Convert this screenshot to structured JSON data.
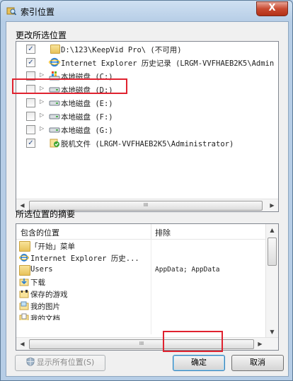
{
  "window": {
    "title": "索引位置",
    "close_label": "X"
  },
  "locations_group": {
    "label": "更改所选位置",
    "items": [
      {
        "checked": true,
        "check_mark": "✓",
        "expander": "",
        "icon": "folder-icon",
        "label": "D:\\123\\KeepVid Pro\\ (不可用)"
      },
      {
        "checked": true,
        "check_mark": "✓",
        "expander": "",
        "icon": "internet-explorer-icon",
        "label": "Internet Explorer 历史记录 (LRGM-VVFHAEB2K5\\Admin"
      },
      {
        "checked": false,
        "check_mark": "",
        "expander": "▷",
        "icon": "windows-drive-icon",
        "label": "本地磁盘 (C:)"
      },
      {
        "checked": false,
        "check_mark": "",
        "expander": "▷",
        "icon": "drive-icon",
        "label": "本地磁盘 (D:)"
      },
      {
        "checked": false,
        "check_mark": "",
        "expander": "▷",
        "icon": "drive-icon",
        "label": "本地磁盘 (E:)"
      },
      {
        "checked": false,
        "check_mark": "",
        "expander": "▷",
        "icon": "drive-icon",
        "label": "本地磁盘 (F:)"
      },
      {
        "checked": false,
        "check_mark": "",
        "expander": "▷",
        "icon": "drive-icon",
        "label": "本地磁盘 (G:)"
      },
      {
        "checked": true,
        "check_mark": "✓",
        "expander": "",
        "icon": "offline-files-icon",
        "label": "脱机文件 (LRGM-VVFHAEB2K5\\Administrator)"
      }
    ]
  },
  "summary_group": {
    "label": "所选位置的摘要",
    "col_included": "包含的位置",
    "col_excluded": "排除",
    "rows": [
      {
        "icon": "folder-icon",
        "location": "「开始」菜单",
        "excluded": ""
      },
      {
        "icon": "internet-explorer-icon",
        "location": "Internet Explorer 历史...",
        "excluded": ""
      },
      {
        "icon": "folder-icon",
        "location": "Users",
        "excluded": "AppData; AppData"
      },
      {
        "icon": "download-folder-icon",
        "location": "下载",
        "excluded": ""
      },
      {
        "icon": "games-folder-icon",
        "location": "保存的游戏",
        "excluded": ""
      },
      {
        "icon": "pictures-folder-icon",
        "location": "我的图片",
        "excluded": ""
      },
      {
        "icon": "documents-folder-icon",
        "location": "我的文档",
        "excluded": ""
      }
    ]
  },
  "buttons": {
    "show_all": "显示所有位置(S)",
    "ok": "确定",
    "cancel": "取消"
  },
  "scroll_arrows": {
    "left": "◀",
    "right": "▶",
    "up": "▲",
    "down": "▼",
    "grip": "III"
  },
  "colors": {
    "highlight": "#e0222f",
    "close": "#c84a31"
  }
}
